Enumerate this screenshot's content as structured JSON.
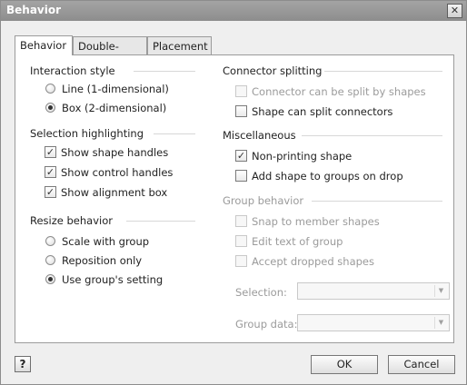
{
  "window": {
    "title": "Behavior",
    "close_glyph": "✕"
  },
  "tabs": [
    {
      "label": "Behavior",
      "active": true
    },
    {
      "label": "Double-Click",
      "active": false
    },
    {
      "label": "Placement",
      "active": false
    }
  ],
  "interaction_style": {
    "heading": "Interaction style",
    "options": [
      "Line (1-dimensional)",
      "Box (2-dimensional)"
    ],
    "selected": "Box (2-dimensional)"
  },
  "selection_highlighting": {
    "heading": "Selection highlighting",
    "options": [
      {
        "label": "Show shape handles",
        "checked": true
      },
      {
        "label": "Show control handles",
        "checked": true
      },
      {
        "label": "Show alignment box",
        "checked": true
      }
    ]
  },
  "resize_behavior": {
    "heading": "Resize behavior",
    "options": [
      "Scale with group",
      "Reposition only",
      "Use group's setting"
    ],
    "selected": "Use group's setting"
  },
  "connector_splitting": {
    "heading": "Connector splitting",
    "options": [
      {
        "label": "Connector can be split by shapes",
        "checked": false,
        "enabled": false
      },
      {
        "label": "Shape can split connectors",
        "checked": false,
        "enabled": true
      }
    ]
  },
  "miscellaneous": {
    "heading": "Miscellaneous",
    "options": [
      {
        "label": "Non-printing shape",
        "checked": true
      },
      {
        "label": "Add shape to groups on drop",
        "checked": false
      }
    ]
  },
  "group_behavior": {
    "heading": "Group behavior",
    "options": [
      {
        "label": "Snap to member shapes",
        "checked": false,
        "enabled": false
      },
      {
        "label": "Edit text of group",
        "checked": false,
        "enabled": false
      },
      {
        "label": "Accept dropped shapes",
        "checked": false,
        "enabled": false
      }
    ],
    "selection_label": "Selection:",
    "selection_value": "",
    "group_data_label": "Group data:",
    "group_data_value": ""
  },
  "footer": {
    "help_glyph": "?",
    "ok_label": "OK",
    "cancel_label": "Cancel"
  },
  "glyphs": {
    "check": "✓",
    "dropdown": "▼"
  }
}
